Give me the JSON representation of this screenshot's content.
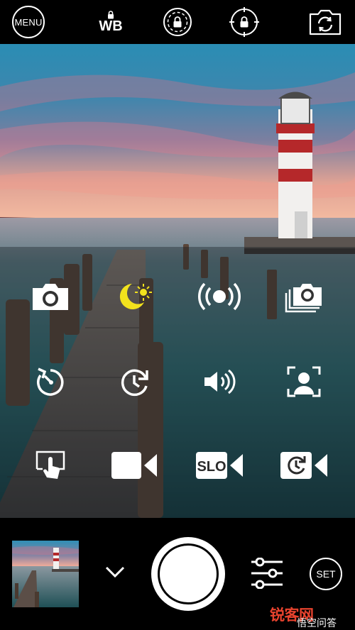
{
  "top_bar": {
    "menu_label": "MENU",
    "wb_label": "WB",
    "icons": [
      "lock-icon",
      "exposure-lock-icon",
      "focus-lock-icon",
      "camera-switch-icon"
    ]
  },
  "modes": [
    {
      "name": "photo-mode",
      "icon": "camera-icon"
    },
    {
      "name": "night-mode",
      "icon": "moon-sun-icon",
      "active": true,
      "active_color": "#f2e21d"
    },
    {
      "name": "stabilizer-mode",
      "icon": "broadcast-icon"
    },
    {
      "name": "burst-mode",
      "icon": "burst-camera-icon"
    },
    {
      "name": "self-timer-mode",
      "icon": "timer-icon"
    },
    {
      "name": "interval-mode",
      "icon": "interval-icon"
    },
    {
      "name": "sound-trigger-mode",
      "icon": "volume-icon"
    },
    {
      "name": "portrait-mode",
      "icon": "portrait-icon"
    },
    {
      "name": "touch-shutter-mode",
      "icon": "touch-icon"
    },
    {
      "name": "video-mode",
      "icon": "video-icon"
    },
    {
      "name": "slow-motion-mode",
      "icon": "slo-video-icon",
      "label": "SLO"
    },
    {
      "name": "timelapse-mode",
      "icon": "timelapse-video-icon"
    }
  ],
  "bottom_bar": {
    "set_label": "SET",
    "watermark_logo": "锐客网",
    "watermark_sub": "悟空问答"
  },
  "colors": {
    "accent": "#f2e21d",
    "bar_bg": "#000000",
    "icon": "#ffffff"
  }
}
